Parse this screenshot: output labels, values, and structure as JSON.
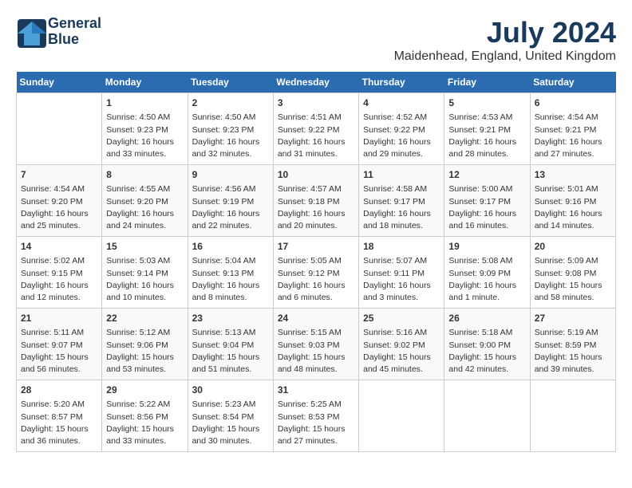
{
  "header": {
    "logo_line1": "General",
    "logo_line2": "Blue",
    "month_year": "July 2024",
    "location": "Maidenhead, England, United Kingdom"
  },
  "days_of_week": [
    "Sunday",
    "Monday",
    "Tuesday",
    "Wednesday",
    "Thursday",
    "Friday",
    "Saturday"
  ],
  "weeks": [
    [
      {
        "day": "",
        "info": ""
      },
      {
        "day": "1",
        "info": "Sunrise: 4:50 AM\nSunset: 9:23 PM\nDaylight: 16 hours\nand 33 minutes."
      },
      {
        "day": "2",
        "info": "Sunrise: 4:50 AM\nSunset: 9:23 PM\nDaylight: 16 hours\nand 32 minutes."
      },
      {
        "day": "3",
        "info": "Sunrise: 4:51 AM\nSunset: 9:22 PM\nDaylight: 16 hours\nand 31 minutes."
      },
      {
        "day": "4",
        "info": "Sunrise: 4:52 AM\nSunset: 9:22 PM\nDaylight: 16 hours\nand 29 minutes."
      },
      {
        "day": "5",
        "info": "Sunrise: 4:53 AM\nSunset: 9:21 PM\nDaylight: 16 hours\nand 28 minutes."
      },
      {
        "day": "6",
        "info": "Sunrise: 4:54 AM\nSunset: 9:21 PM\nDaylight: 16 hours\nand 27 minutes."
      }
    ],
    [
      {
        "day": "7",
        "info": "Sunrise: 4:54 AM\nSunset: 9:20 PM\nDaylight: 16 hours\nand 25 minutes."
      },
      {
        "day": "8",
        "info": "Sunrise: 4:55 AM\nSunset: 9:20 PM\nDaylight: 16 hours\nand 24 minutes."
      },
      {
        "day": "9",
        "info": "Sunrise: 4:56 AM\nSunset: 9:19 PM\nDaylight: 16 hours\nand 22 minutes."
      },
      {
        "day": "10",
        "info": "Sunrise: 4:57 AM\nSunset: 9:18 PM\nDaylight: 16 hours\nand 20 minutes."
      },
      {
        "day": "11",
        "info": "Sunrise: 4:58 AM\nSunset: 9:17 PM\nDaylight: 16 hours\nand 18 minutes."
      },
      {
        "day": "12",
        "info": "Sunrise: 5:00 AM\nSunset: 9:17 PM\nDaylight: 16 hours\nand 16 minutes."
      },
      {
        "day": "13",
        "info": "Sunrise: 5:01 AM\nSunset: 9:16 PM\nDaylight: 16 hours\nand 14 minutes."
      }
    ],
    [
      {
        "day": "14",
        "info": "Sunrise: 5:02 AM\nSunset: 9:15 PM\nDaylight: 16 hours\nand 12 minutes."
      },
      {
        "day": "15",
        "info": "Sunrise: 5:03 AM\nSunset: 9:14 PM\nDaylight: 16 hours\nand 10 minutes."
      },
      {
        "day": "16",
        "info": "Sunrise: 5:04 AM\nSunset: 9:13 PM\nDaylight: 16 hours\nand 8 minutes."
      },
      {
        "day": "17",
        "info": "Sunrise: 5:05 AM\nSunset: 9:12 PM\nDaylight: 16 hours\nand 6 minutes."
      },
      {
        "day": "18",
        "info": "Sunrise: 5:07 AM\nSunset: 9:11 PM\nDaylight: 16 hours\nand 3 minutes."
      },
      {
        "day": "19",
        "info": "Sunrise: 5:08 AM\nSunset: 9:09 PM\nDaylight: 16 hours\nand 1 minute."
      },
      {
        "day": "20",
        "info": "Sunrise: 5:09 AM\nSunset: 9:08 PM\nDaylight: 15 hours\nand 58 minutes."
      }
    ],
    [
      {
        "day": "21",
        "info": "Sunrise: 5:11 AM\nSunset: 9:07 PM\nDaylight: 15 hours\nand 56 minutes."
      },
      {
        "day": "22",
        "info": "Sunrise: 5:12 AM\nSunset: 9:06 PM\nDaylight: 15 hours\nand 53 minutes."
      },
      {
        "day": "23",
        "info": "Sunrise: 5:13 AM\nSunset: 9:04 PM\nDaylight: 15 hours\nand 51 minutes."
      },
      {
        "day": "24",
        "info": "Sunrise: 5:15 AM\nSunset: 9:03 PM\nDaylight: 15 hours\nand 48 minutes."
      },
      {
        "day": "25",
        "info": "Sunrise: 5:16 AM\nSunset: 9:02 PM\nDaylight: 15 hours\nand 45 minutes."
      },
      {
        "day": "26",
        "info": "Sunrise: 5:18 AM\nSunset: 9:00 PM\nDaylight: 15 hours\nand 42 minutes."
      },
      {
        "day": "27",
        "info": "Sunrise: 5:19 AM\nSunset: 8:59 PM\nDaylight: 15 hours\nand 39 minutes."
      }
    ],
    [
      {
        "day": "28",
        "info": "Sunrise: 5:20 AM\nSunset: 8:57 PM\nDaylight: 15 hours\nand 36 minutes."
      },
      {
        "day": "29",
        "info": "Sunrise: 5:22 AM\nSunset: 8:56 PM\nDaylight: 15 hours\nand 33 minutes."
      },
      {
        "day": "30",
        "info": "Sunrise: 5:23 AM\nSunset: 8:54 PM\nDaylight: 15 hours\nand 30 minutes."
      },
      {
        "day": "31",
        "info": "Sunrise: 5:25 AM\nSunset: 8:53 PM\nDaylight: 15 hours\nand 27 minutes."
      },
      {
        "day": "",
        "info": ""
      },
      {
        "day": "",
        "info": ""
      },
      {
        "day": "",
        "info": ""
      }
    ]
  ]
}
